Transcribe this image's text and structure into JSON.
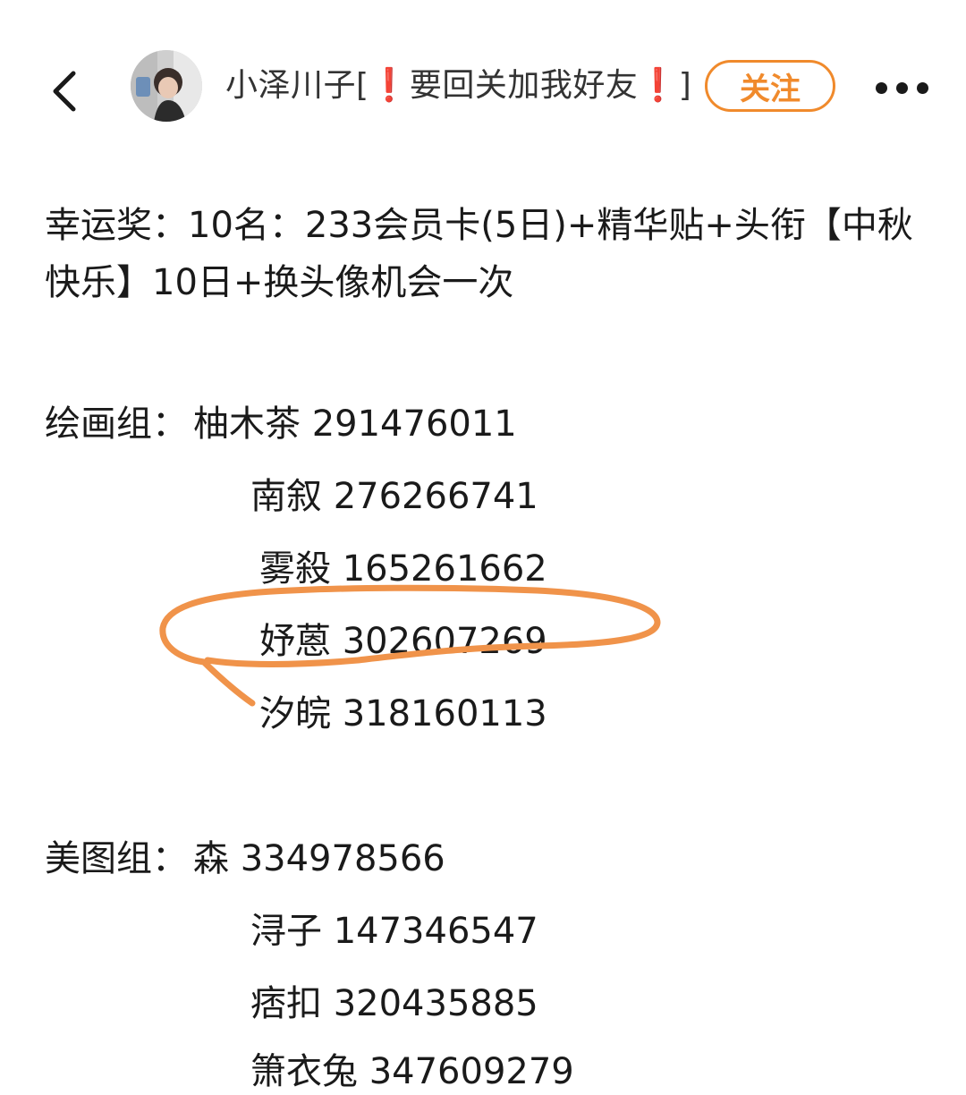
{
  "header": {
    "back_icon": "chevron-left-icon",
    "username": "小泽川子[❗要回关加我好友❗]",
    "follow_label": "关注",
    "more_icon": "more-dots-icon",
    "accent_color": "#f08a2c"
  },
  "post": {
    "prize": "幸运奖：10名：233会员卡(5日)+精华贴+头衔【中秋快乐】10日+换头像机会一次",
    "drawing_group": {
      "label": "绘画组：",
      "entries": [
        "柚木茶 291476011",
        "南叙 276266741",
        "雾殺 165261662",
        "妤蒽 302607269",
        "汐皖 318160113"
      ]
    },
    "design_group": {
      "label": "美图组：",
      "entries": [
        "森 334978566",
        "浔子 147346547",
        "痞扣 320435885",
        "箫衣兔 347609279"
      ]
    }
  },
  "annotation": {
    "color": "#f0934a",
    "icon": "hand-drawn-circle-annotation"
  }
}
